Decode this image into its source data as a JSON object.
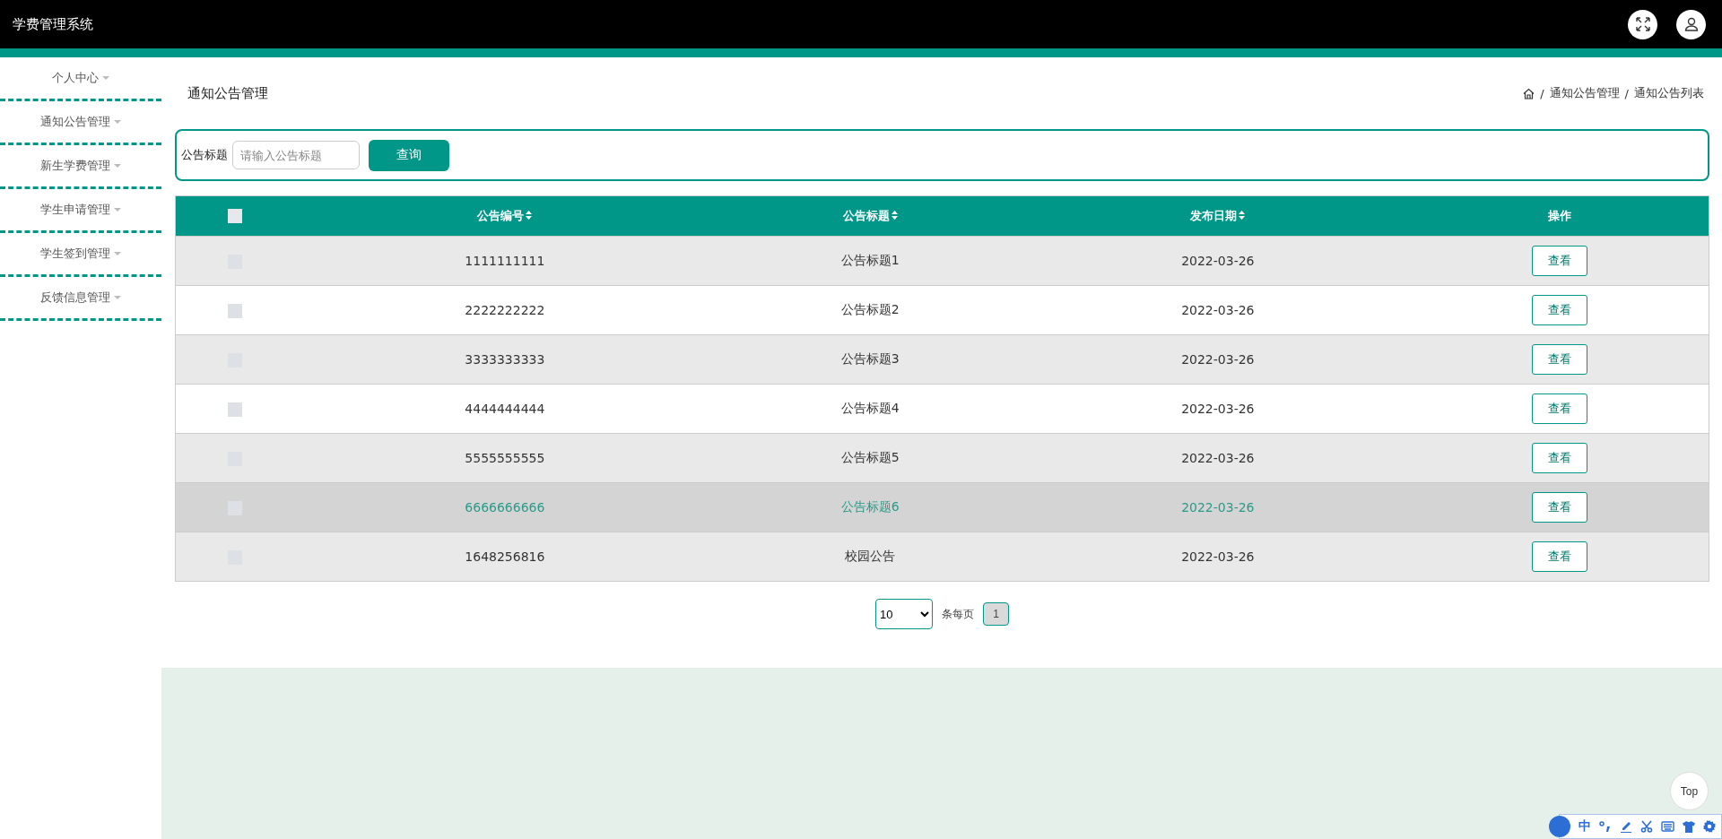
{
  "header": {
    "title": "学费管理系统"
  },
  "sidebar": {
    "items": [
      {
        "label": "个人中心"
      },
      {
        "label": "通知公告管理"
      },
      {
        "label": "新生学费管理"
      },
      {
        "label": "学生申请管理"
      },
      {
        "label": "学生签到管理"
      },
      {
        "label": "反馈信息管理"
      }
    ]
  },
  "page_title": "通知公告管理",
  "breadcrumb": {
    "separator": "/",
    "items": [
      "通知公告管理",
      "通知公告列表"
    ]
  },
  "search": {
    "label": "公告标题",
    "placeholder": "请输入公告标题",
    "button": "查询"
  },
  "table": {
    "select_all_checked": false,
    "columns": [
      {
        "label": "公告编号",
        "sortable": true
      },
      {
        "label": "公告标题",
        "sortable": true
      },
      {
        "label": "发布日期",
        "sortable": true
      },
      {
        "label": "操作",
        "sortable": false
      }
    ],
    "rows": [
      {
        "cells": [
          "1111111111",
          "公告标题1",
          "2022-03-26"
        ],
        "action": "查看",
        "hovered": false
      },
      {
        "cells": [
          "2222222222",
          "公告标题2",
          "2022-03-26"
        ],
        "action": "查看",
        "hovered": false
      },
      {
        "cells": [
          "3333333333",
          "公告标题3",
          "2022-03-26"
        ],
        "action": "查看",
        "hovered": false
      },
      {
        "cells": [
          "4444444444",
          "公告标题4",
          "2022-03-26"
        ],
        "action": "查看",
        "hovered": false
      },
      {
        "cells": [
          "5555555555",
          "公告标题5",
          "2022-03-26"
        ],
        "action": "查看",
        "hovered": false
      },
      {
        "cells": [
          "6666666666",
          "公告标题6",
          "2022-03-26"
        ],
        "action": "查看",
        "hovered": true
      },
      {
        "cells": [
          "1648256816",
          "校园公告",
          "2022-03-26"
        ],
        "action": "查看",
        "hovered": false
      }
    ]
  },
  "pagination": {
    "page_size": "10",
    "per_page_label": "条每页",
    "pages": [
      {
        "label": "1",
        "selected": true
      }
    ]
  },
  "back_to_top": "Top",
  "ime_toolbar": {
    "mode": "中"
  }
}
